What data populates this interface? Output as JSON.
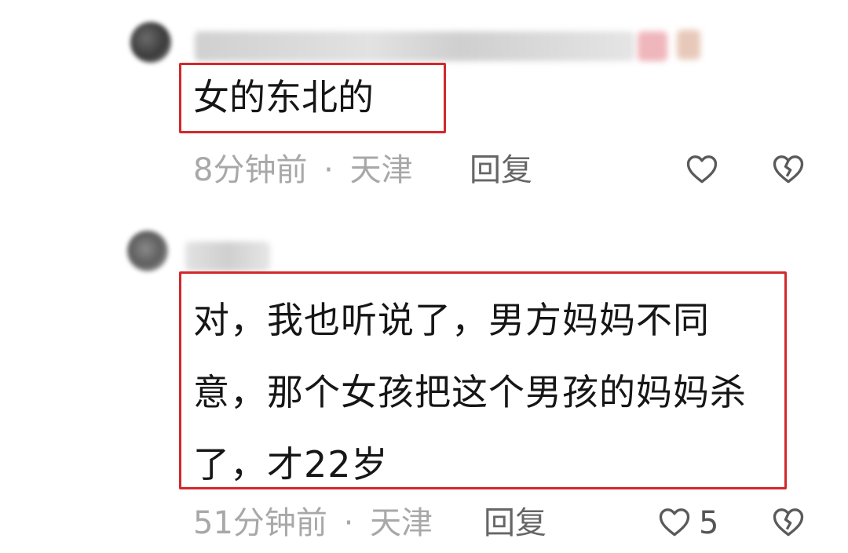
{
  "comments": [
    {
      "text": "女的东北的",
      "time": "8分钟前",
      "separator": "·",
      "location": "天津",
      "reply_label": "回复",
      "like_count": "",
      "icons": [
        "heart-outline-icon",
        "broken-heart-icon"
      ]
    },
    {
      "text": "对，我也听说了，男方妈妈不同意，那个女孩把这个男孩的妈妈杀了，才22岁",
      "time": "51分钟前",
      "separator": "·",
      "location": "天津",
      "reply_label": "回复",
      "like_count": "5",
      "icons": [
        "heart-outline-icon",
        "broken-heart-icon"
      ]
    }
  ],
  "colors": {
    "highlight_border": "#d3282b",
    "meta_text": "#a8a8a8",
    "reply_text": "#666666",
    "icon_stroke": "#5a5a5a"
  }
}
